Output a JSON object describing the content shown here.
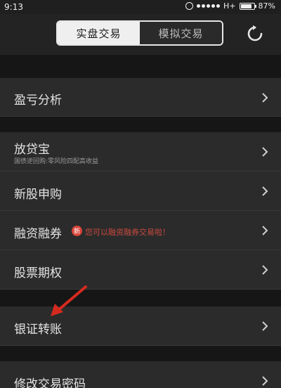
{
  "status_bar": {
    "time": "9:13",
    "carrier": "H+",
    "battery": "87%",
    "battery_level": 0.87
  },
  "header": {
    "tabs": [
      {
        "label": "实盘交易",
        "active": true
      },
      {
        "label": "模拟交易",
        "active": false
      }
    ],
    "refresh_icon": "refresh-icon"
  },
  "menu": {
    "profit_analysis": {
      "label": "盈亏分析"
    },
    "loan_treasure": {
      "label": "放贷宝",
      "subtitle": "国债逆回购:零风险四配高收益"
    },
    "ipo_subscription": {
      "label": "新股申购"
    },
    "margin_trading": {
      "label": "融资融券",
      "badge": "新",
      "promo": "您可以融资融券交易啦！"
    },
    "stock_options": {
      "label": "股票期权"
    },
    "bank_transfer": {
      "label": "银证转账"
    },
    "change_password": {
      "label": "修改交易密码"
    }
  },
  "colors": {
    "accent_red": "#d9443a",
    "annotation_arrow": "#d42a1e"
  }
}
